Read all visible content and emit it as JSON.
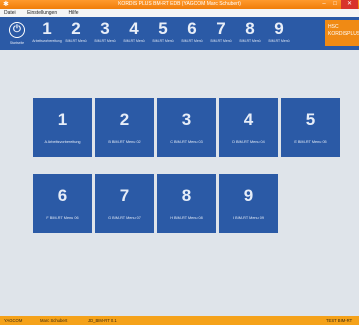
{
  "titlebar": {
    "title": "KORDIS PLUS BM-RT EDB (YAGCOM Marc Schubert)",
    "minimize": "–",
    "maximize": "□",
    "close": "✕"
  },
  "menu": [
    "Datei",
    "Einstellungen",
    "Hilfe"
  ],
  "nav": {
    "home": {
      "label": "Startseite",
      "icon": "power-icon"
    },
    "items": [
      {
        "num": "1",
        "label": "Arbeitsvorbereitung"
      },
      {
        "num": "2",
        "label": "BIM-RT Menü"
      },
      {
        "num": "3",
        "label": "BIM-RT Menü"
      },
      {
        "num": "4",
        "label": "BIM-RT Menü"
      },
      {
        "num": "5",
        "label": "BIM-RT Menü"
      },
      {
        "num": "6",
        "label": "BIM-RT Menü"
      },
      {
        "num": "7",
        "label": "BIM-RT Menü"
      },
      {
        "num": "8",
        "label": "BIM-RT Menü"
      },
      {
        "num": "9",
        "label": "BIM-RT Menü"
      }
    ]
  },
  "logo": {
    "line1": "HSC",
    "line2": "KORDISPLUS"
  },
  "tiles": [
    {
      "num": "1",
      "label": "A Arbeitsvorbereitung"
    },
    {
      "num": "2",
      "label": "B BIM-RT Menu 02"
    },
    {
      "num": "3",
      "label": "C BIM-RT Menu 03"
    },
    {
      "num": "4",
      "label": "D BIM-RT Menu 04"
    },
    {
      "num": "5",
      "label": "E BIM-RT Menu 05"
    },
    {
      "num": "6",
      "label": "F BIM-RT Menu 06"
    },
    {
      "num": "7",
      "label": "G BIM-RT Menu 07"
    },
    {
      "num": "8",
      "label": "H BIM-RT Menu 08"
    },
    {
      "num": "9",
      "label": "I BIM-RT Menu 09"
    }
  ],
  "status": {
    "company": "YAGCOM",
    "user": "Marc Schubert",
    "db": "JD_BIM-RT 0.1",
    "right": "TEST BIM-RT"
  },
  "colors": {
    "accent": "#f5a21a",
    "tile": "#2b5aa6",
    "background": "#dfe4ea"
  }
}
